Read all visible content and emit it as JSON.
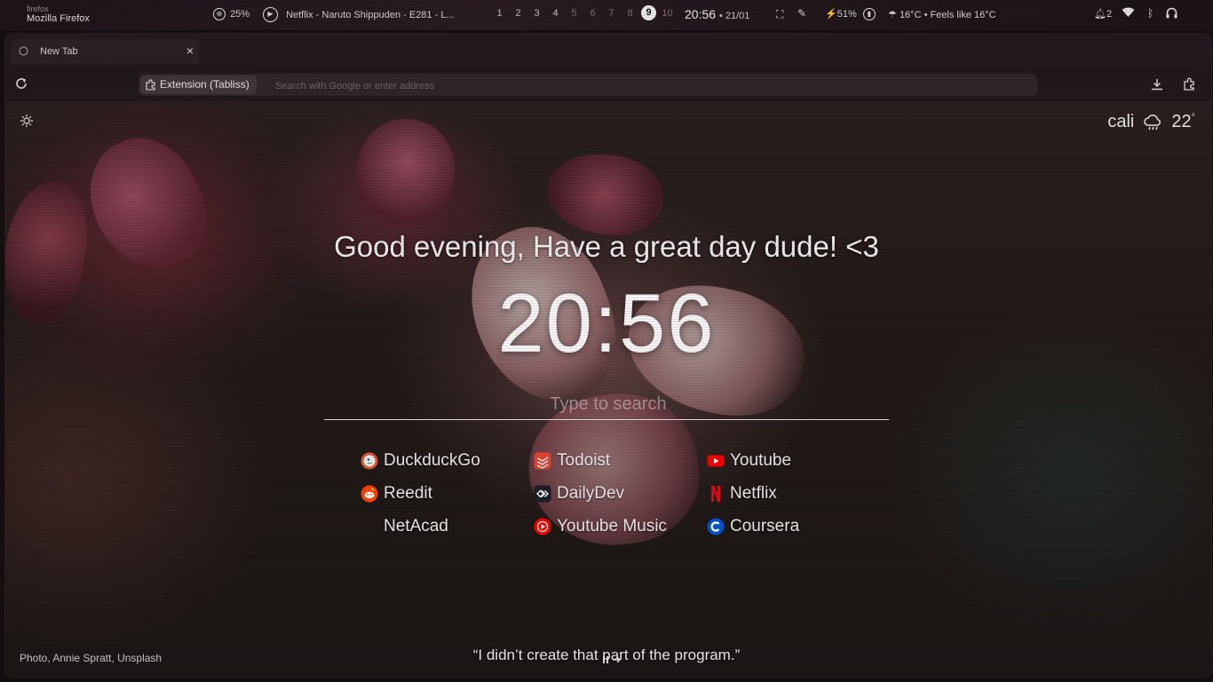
{
  "system_bar": {
    "window_class": "firefox",
    "window_name": "Mozilla Firefox",
    "cpu_percent": "25%",
    "media_title": "Netflix - Naruto Shippuden - E281 - L...",
    "workspaces": [
      "1",
      "2",
      "3",
      "4",
      "5",
      "6",
      "7",
      "8",
      "9",
      "10"
    ],
    "active_workspace": "9",
    "time": "20:56",
    "date": "• 21/01",
    "battery": "51%",
    "weather": "16°C • Feels like 16°C",
    "notifications": "2"
  },
  "browser": {
    "tab_title": "New Tab",
    "tab_close": "×",
    "extension_chip": "Extension (Tabliss)",
    "url_placeholder": "Search with Google or enter address"
  },
  "tabliss": {
    "location": "cali",
    "temperature": "22",
    "temperature_unit": "°",
    "greeting": "Good evening, Have a great day dude! <3",
    "clock": "20:56",
    "search_placeholder": "Type to search",
    "links": [
      {
        "label": "DuckduckGo",
        "icon": "duckduckgo-icon",
        "color": "#de5833"
      },
      {
        "label": "Todoist",
        "icon": "todoist-icon",
        "color": "#e44332"
      },
      {
        "label": "Youtube",
        "icon": "youtube-icon",
        "color": "#ff0000"
      },
      {
        "label": "Reedit",
        "icon": "reddit-icon",
        "color": "#ff4500"
      },
      {
        "label": "DailyDev",
        "icon": "dailydev-icon",
        "color": "#1c1f26"
      },
      {
        "label": "Netflix",
        "icon": "netflix-icon",
        "color": "#e50914"
      },
      {
        "label": "NetAcad",
        "icon": "",
        "color": ""
      },
      {
        "label": "Youtube Music",
        "icon": "youtube-music-icon",
        "color": "#ff0000"
      },
      {
        "label": "Coursera",
        "icon": "coursera-icon",
        "color": "#0056d2"
      }
    ],
    "quote": "“I didn’t create that part of the program.”",
    "photo_credit": "Photo, Annie Spratt, Unsplash"
  }
}
